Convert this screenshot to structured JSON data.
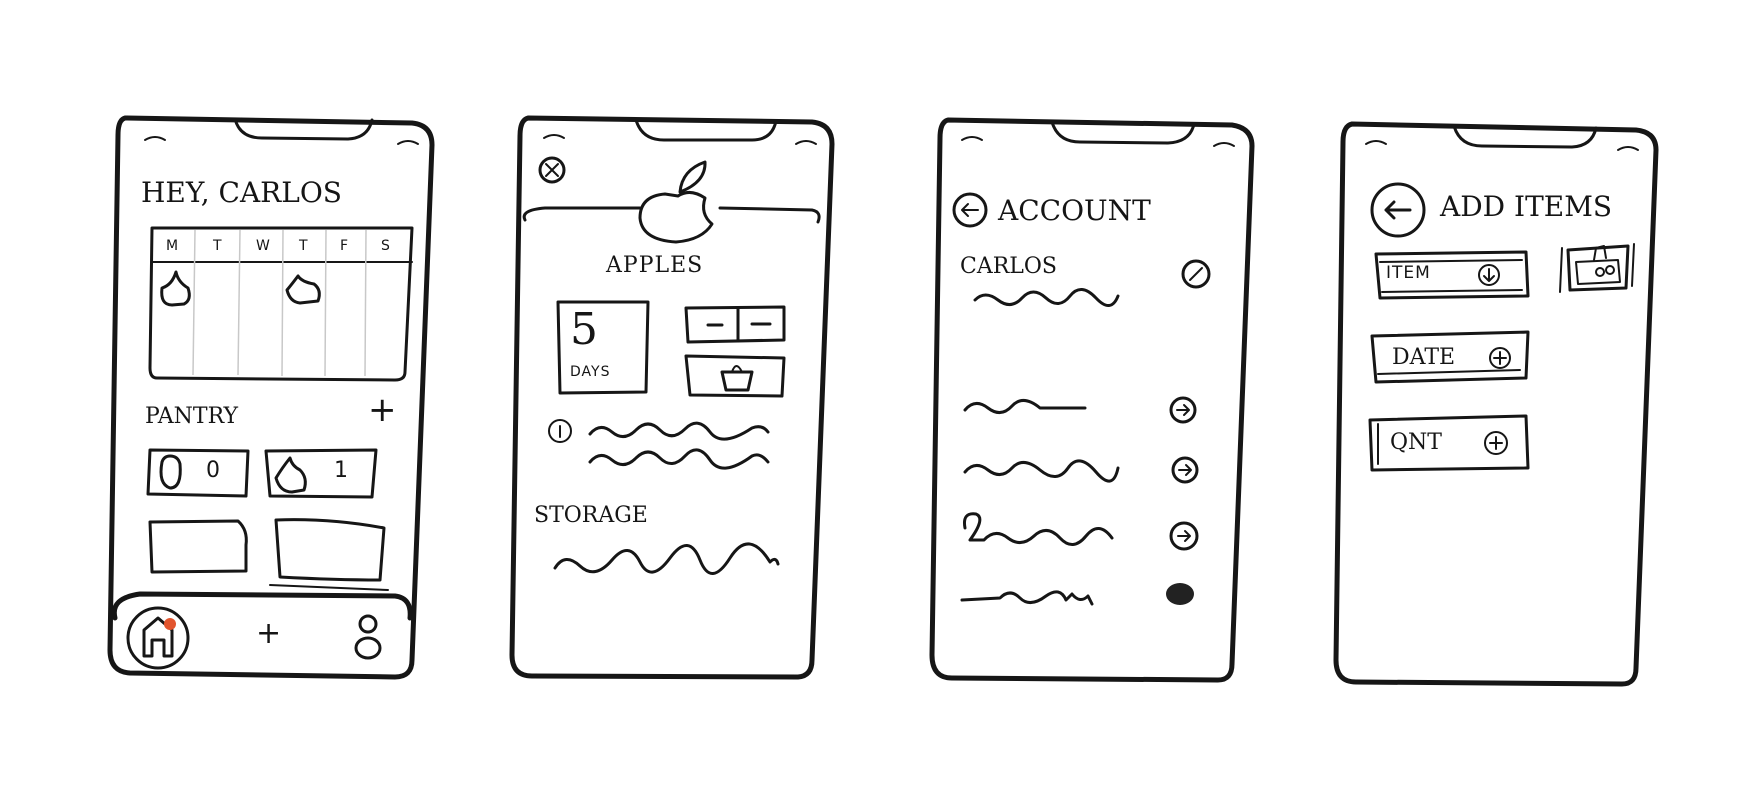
{
  "screens": {
    "home": {
      "greeting": "HEY, CARLOS",
      "weekdays": [
        "M",
        "T",
        "W",
        "T",
        "F",
        "S"
      ],
      "pantry_title": "PANTRY",
      "add_symbol": "+",
      "pantry_tiles": [
        {
          "icon": "jar-icon",
          "count": "0"
        },
        {
          "icon": "apple-icon",
          "count": "1"
        }
      ],
      "nav": {
        "add_symbol": "+"
      }
    },
    "item_detail": {
      "title": "APPLES",
      "days_value": "5",
      "days_label": "DAYS",
      "storage_title": "STORAGE"
    },
    "account": {
      "title": "ACCOUNT",
      "user_name": "CARLOS"
    },
    "add_items": {
      "title": "ADD ITEMS",
      "fields": [
        {
          "label": "ITEM"
        },
        {
          "label": "DATE"
        },
        {
          "label": "QNT"
        }
      ]
    }
  },
  "colors": {
    "ink": "#161616",
    "accent_dot": "#e2552e",
    "paper": "#ffffff"
  }
}
